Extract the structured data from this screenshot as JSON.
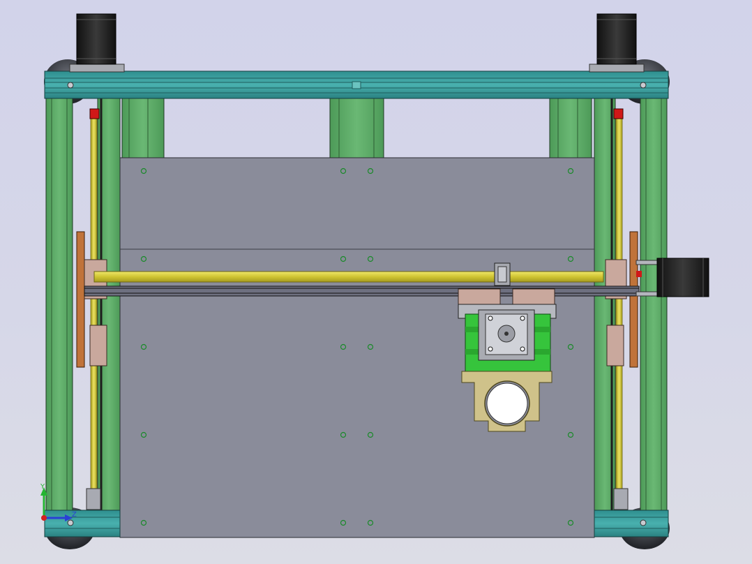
{
  "viewport": {
    "background_color": "#d4d5e8"
  },
  "model": {
    "colors": {
      "aluminum_extrusion": "#5ea868",
      "frame_top": "#3f9e9e",
      "build_plate": "#8a8c9a",
      "threaded_rod": "#d2c83a",
      "stepper_motor": "#1c1c1c",
      "bracket_copper": "#c0733a",
      "carriage_block": "#c9a89d",
      "extruder_green": "#36c43c",
      "extruder_mount": "#cfc28a",
      "end_stop_red": "#d01818"
    }
  },
  "triad": {
    "y_label": "Y",
    "x_label": "Z",
    "colors": {
      "y_axis": "#25b532",
      "x_axis": "#2a3fd6",
      "z_axis": "#d42020"
    }
  }
}
